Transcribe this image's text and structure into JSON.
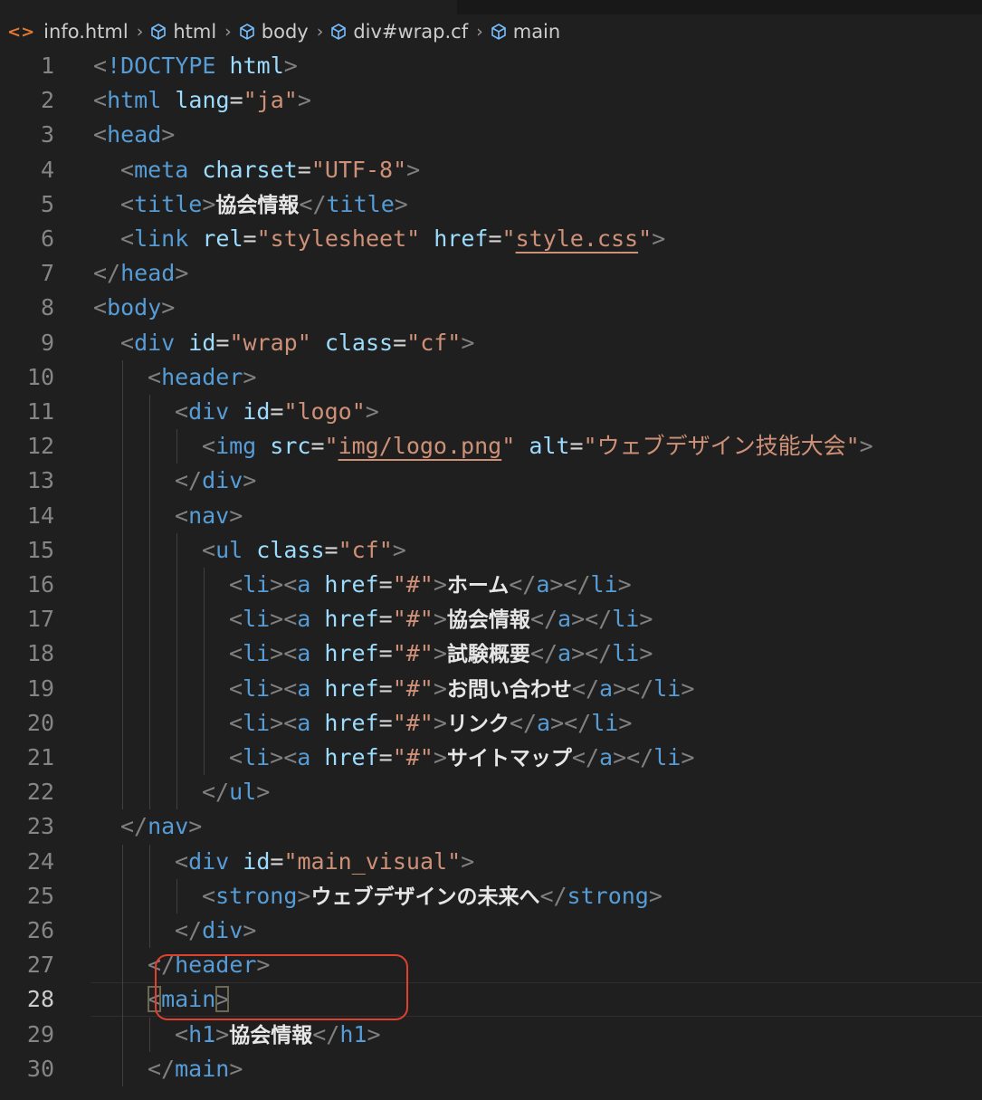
{
  "breadcrumb": {
    "items": [
      {
        "label": "info.html",
        "icon": "html-file-icon"
      },
      {
        "label": "html",
        "icon": "element-cube-icon"
      },
      {
        "label": "body",
        "icon": "element-cube-icon"
      },
      {
        "label": "div#wrap.cf",
        "icon": "element-cube-icon"
      },
      {
        "label": "main",
        "icon": "element-cube-icon"
      }
    ]
  },
  "editor": {
    "active_line": 28,
    "lines": [
      {
        "n": 1,
        "indent": 0,
        "tokens": [
          [
            "p",
            "<"
          ],
          [
            "t",
            "!DOCTYPE"
          ],
          [
            "x",
            " "
          ],
          [
            "a",
            "html"
          ],
          [
            "p",
            ">"
          ]
        ]
      },
      {
        "n": 2,
        "indent": 0,
        "tokens": [
          [
            "p",
            "<"
          ],
          [
            "t",
            "html"
          ],
          [
            "x",
            " "
          ],
          [
            "a",
            "lang"
          ],
          [
            "x",
            "="
          ],
          [
            "s",
            "\"ja\""
          ],
          [
            "p",
            ">"
          ]
        ]
      },
      {
        "n": 3,
        "indent": 0,
        "tokens": [
          [
            "p",
            "<"
          ],
          [
            "t",
            "head"
          ],
          [
            "p",
            ">"
          ]
        ]
      },
      {
        "n": 4,
        "indent": 1,
        "tokens": [
          [
            "p",
            "<"
          ],
          [
            "t",
            "meta"
          ],
          [
            "x",
            " "
          ],
          [
            "a",
            "charset"
          ],
          [
            "x",
            "="
          ],
          [
            "s",
            "\"UTF-8\""
          ],
          [
            "p",
            ">"
          ]
        ]
      },
      {
        "n": 5,
        "indent": 1,
        "tokens": [
          [
            "p",
            "<"
          ],
          [
            "t",
            "title"
          ],
          [
            "p",
            ">"
          ],
          [
            "jp",
            "協会情報"
          ],
          [
            "p",
            "</"
          ],
          [
            "t",
            "title"
          ],
          [
            "p",
            ">"
          ]
        ]
      },
      {
        "n": 6,
        "indent": 1,
        "tokens": [
          [
            "p",
            "<"
          ],
          [
            "t",
            "link"
          ],
          [
            "x",
            " "
          ],
          [
            "a",
            "rel"
          ],
          [
            "x",
            "="
          ],
          [
            "s",
            "\"stylesheet\""
          ],
          [
            "x",
            " "
          ],
          [
            "a",
            "href"
          ],
          [
            "x",
            "="
          ],
          [
            "s",
            "\""
          ],
          [
            "su",
            "style.css"
          ],
          [
            "s",
            "\""
          ],
          [
            "p",
            ">"
          ]
        ]
      },
      {
        "n": 7,
        "indent": 0,
        "tokens": [
          [
            "p",
            "</"
          ],
          [
            "t",
            "head"
          ],
          [
            "p",
            ">"
          ]
        ]
      },
      {
        "n": 8,
        "indent": 0,
        "tokens": [
          [
            "p",
            "<"
          ],
          [
            "t",
            "body"
          ],
          [
            "p",
            ">"
          ]
        ]
      },
      {
        "n": 9,
        "indent": 1,
        "tokens": [
          [
            "p",
            "<"
          ],
          [
            "t",
            "div"
          ],
          [
            "x",
            " "
          ],
          [
            "a",
            "id"
          ],
          [
            "x",
            "="
          ],
          [
            "s",
            "\"wrap\""
          ],
          [
            "x",
            " "
          ],
          [
            "a",
            "class"
          ],
          [
            "x",
            "="
          ],
          [
            "s",
            "\"cf\""
          ],
          [
            "p",
            ">"
          ]
        ]
      },
      {
        "n": 10,
        "indent": 2,
        "tokens": [
          [
            "p",
            "<"
          ],
          [
            "t",
            "header"
          ],
          [
            "p",
            ">"
          ]
        ]
      },
      {
        "n": 11,
        "indent": 3,
        "tokens": [
          [
            "p",
            "<"
          ],
          [
            "t",
            "div"
          ],
          [
            "x",
            " "
          ],
          [
            "a",
            "id"
          ],
          [
            "x",
            "="
          ],
          [
            "s",
            "\"logo\""
          ],
          [
            "p",
            ">"
          ]
        ]
      },
      {
        "n": 12,
        "indent": 4,
        "tokens": [
          [
            "p",
            "<"
          ],
          [
            "t",
            "img"
          ],
          [
            "x",
            " "
          ],
          [
            "a",
            "src"
          ],
          [
            "x",
            "="
          ],
          [
            "s",
            "\""
          ],
          [
            "su",
            "img/logo.png"
          ],
          [
            "s",
            "\""
          ],
          [
            "x",
            " "
          ],
          [
            "a",
            "alt"
          ],
          [
            "x",
            "="
          ],
          [
            "s",
            "\"ウェブデザイン技能大会\""
          ],
          [
            "p",
            ">"
          ]
        ]
      },
      {
        "n": 13,
        "indent": 3,
        "tokens": [
          [
            "p",
            "</"
          ],
          [
            "t",
            "div"
          ],
          [
            "p",
            ">"
          ]
        ]
      },
      {
        "n": 14,
        "indent": 3,
        "tokens": [
          [
            "p",
            "<"
          ],
          [
            "t",
            "nav"
          ],
          [
            "p",
            ">"
          ]
        ]
      },
      {
        "n": 15,
        "indent": 4,
        "tokens": [
          [
            "p",
            "<"
          ],
          [
            "t",
            "ul"
          ],
          [
            "x",
            " "
          ],
          [
            "a",
            "class"
          ],
          [
            "x",
            "="
          ],
          [
            "s",
            "\"cf\""
          ],
          [
            "p",
            ">"
          ]
        ]
      },
      {
        "n": 16,
        "indent": 5,
        "tokens": [
          [
            "p",
            "<"
          ],
          [
            "t",
            "li"
          ],
          [
            "p",
            "><"
          ],
          [
            "t",
            "a"
          ],
          [
            "x",
            " "
          ],
          [
            "a",
            "href"
          ],
          [
            "x",
            "="
          ],
          [
            "s",
            "\"#\""
          ],
          [
            "p",
            ">"
          ],
          [
            "jp",
            "ホーム"
          ],
          [
            "p",
            "</"
          ],
          [
            "t",
            "a"
          ],
          [
            "p",
            "></"
          ],
          [
            "t",
            "li"
          ],
          [
            "p",
            ">"
          ]
        ]
      },
      {
        "n": 17,
        "indent": 5,
        "tokens": [
          [
            "p",
            "<"
          ],
          [
            "t",
            "li"
          ],
          [
            "p",
            "><"
          ],
          [
            "t",
            "a"
          ],
          [
            "x",
            " "
          ],
          [
            "a",
            "href"
          ],
          [
            "x",
            "="
          ],
          [
            "s",
            "\"#\""
          ],
          [
            "p",
            ">"
          ],
          [
            "jp",
            "協会情報"
          ],
          [
            "p",
            "</"
          ],
          [
            "t",
            "a"
          ],
          [
            "p",
            "></"
          ],
          [
            "t",
            "li"
          ],
          [
            "p",
            ">"
          ]
        ]
      },
      {
        "n": 18,
        "indent": 5,
        "tokens": [
          [
            "p",
            "<"
          ],
          [
            "t",
            "li"
          ],
          [
            "p",
            "><"
          ],
          [
            "t",
            "a"
          ],
          [
            "x",
            " "
          ],
          [
            "a",
            "href"
          ],
          [
            "x",
            "="
          ],
          [
            "s",
            "\"#\""
          ],
          [
            "p",
            ">"
          ],
          [
            "jp",
            "試験概要"
          ],
          [
            "p",
            "</"
          ],
          [
            "t",
            "a"
          ],
          [
            "p",
            "></"
          ],
          [
            "t",
            "li"
          ],
          [
            "p",
            ">"
          ]
        ]
      },
      {
        "n": 19,
        "indent": 5,
        "tokens": [
          [
            "p",
            "<"
          ],
          [
            "t",
            "li"
          ],
          [
            "p",
            "><"
          ],
          [
            "t",
            "a"
          ],
          [
            "x",
            " "
          ],
          [
            "a",
            "href"
          ],
          [
            "x",
            "="
          ],
          [
            "s",
            "\"#\""
          ],
          [
            "p",
            ">"
          ],
          [
            "jp",
            "お問い合わせ"
          ],
          [
            "p",
            "</"
          ],
          [
            "t",
            "a"
          ],
          [
            "p",
            "></"
          ],
          [
            "t",
            "li"
          ],
          [
            "p",
            ">"
          ]
        ]
      },
      {
        "n": 20,
        "indent": 5,
        "tokens": [
          [
            "p",
            "<"
          ],
          [
            "t",
            "li"
          ],
          [
            "p",
            "><"
          ],
          [
            "t",
            "a"
          ],
          [
            "x",
            " "
          ],
          [
            "a",
            "href"
          ],
          [
            "x",
            "="
          ],
          [
            "s",
            "\"#\""
          ],
          [
            "p",
            ">"
          ],
          [
            "jp",
            "リンク"
          ],
          [
            "p",
            "</"
          ],
          [
            "t",
            "a"
          ],
          [
            "p",
            "></"
          ],
          [
            "t",
            "li"
          ],
          [
            "p",
            ">"
          ]
        ]
      },
      {
        "n": 21,
        "indent": 5,
        "tokens": [
          [
            "p",
            "<"
          ],
          [
            "t",
            "li"
          ],
          [
            "p",
            "><"
          ],
          [
            "t",
            "a"
          ],
          [
            "x",
            " "
          ],
          [
            "a",
            "href"
          ],
          [
            "x",
            "="
          ],
          [
            "s",
            "\"#\""
          ],
          [
            "p",
            ">"
          ],
          [
            "jp",
            "サイトマップ"
          ],
          [
            "p",
            "</"
          ],
          [
            "t",
            "a"
          ],
          [
            "p",
            "></"
          ],
          [
            "t",
            "li"
          ],
          [
            "p",
            ">"
          ]
        ]
      },
      {
        "n": 22,
        "indent": 4,
        "tokens": [
          [
            "p",
            "</"
          ],
          [
            "t",
            "ul"
          ],
          [
            "p",
            ">"
          ]
        ]
      },
      {
        "n": 23,
        "indent": 1,
        "tokens": [
          [
            "p",
            "</"
          ],
          [
            "t",
            "nav"
          ],
          [
            "p",
            ">"
          ]
        ]
      },
      {
        "n": 24,
        "indent": 3,
        "tokens": [
          [
            "p",
            "<"
          ],
          [
            "t",
            "div"
          ],
          [
            "x",
            " "
          ],
          [
            "a",
            "id"
          ],
          [
            "x",
            "="
          ],
          [
            "s",
            "\"main_visual\""
          ],
          [
            "p",
            ">"
          ]
        ]
      },
      {
        "n": 25,
        "indent": 4,
        "tokens": [
          [
            "p",
            "<"
          ],
          [
            "t",
            "strong"
          ],
          [
            "p",
            ">"
          ],
          [
            "jp",
            "ウェブデザインの未来へ"
          ],
          [
            "p",
            "</"
          ],
          [
            "t",
            "strong"
          ],
          [
            "p",
            ">"
          ]
        ]
      },
      {
        "n": 26,
        "indent": 3,
        "tokens": [
          [
            "p",
            "</"
          ],
          [
            "t",
            "div"
          ],
          [
            "p",
            ">"
          ]
        ]
      },
      {
        "n": 27,
        "indent": 2,
        "tokens": [
          [
            "p",
            "</"
          ],
          [
            "t",
            "header"
          ],
          [
            "p",
            ">"
          ]
        ]
      },
      {
        "n": 28,
        "indent": 2,
        "tokens": [
          [
            "pb",
            "<"
          ],
          [
            "t",
            "main"
          ],
          [
            "pb",
            ">"
          ]
        ]
      },
      {
        "n": 29,
        "indent": 3,
        "tokens": [
          [
            "p",
            "<"
          ],
          [
            "t",
            "h1"
          ],
          [
            "p",
            ">"
          ],
          [
            "jp",
            "協会情報"
          ],
          [
            "p",
            "</"
          ],
          [
            "t",
            "h1"
          ],
          [
            "p",
            ">"
          ]
        ]
      },
      {
        "n": 30,
        "indent": 2,
        "tokens": [
          [
            "p",
            "</"
          ],
          [
            "t",
            "main"
          ],
          [
            "p",
            ">"
          ]
        ]
      }
    ]
  },
  "colors": {
    "background": "#1f1f1f",
    "tag": "#569cd6",
    "attribute": "#9cdcfe",
    "string": "#ce9178",
    "punctuation": "#808080",
    "highlight": "#e0402f"
  }
}
